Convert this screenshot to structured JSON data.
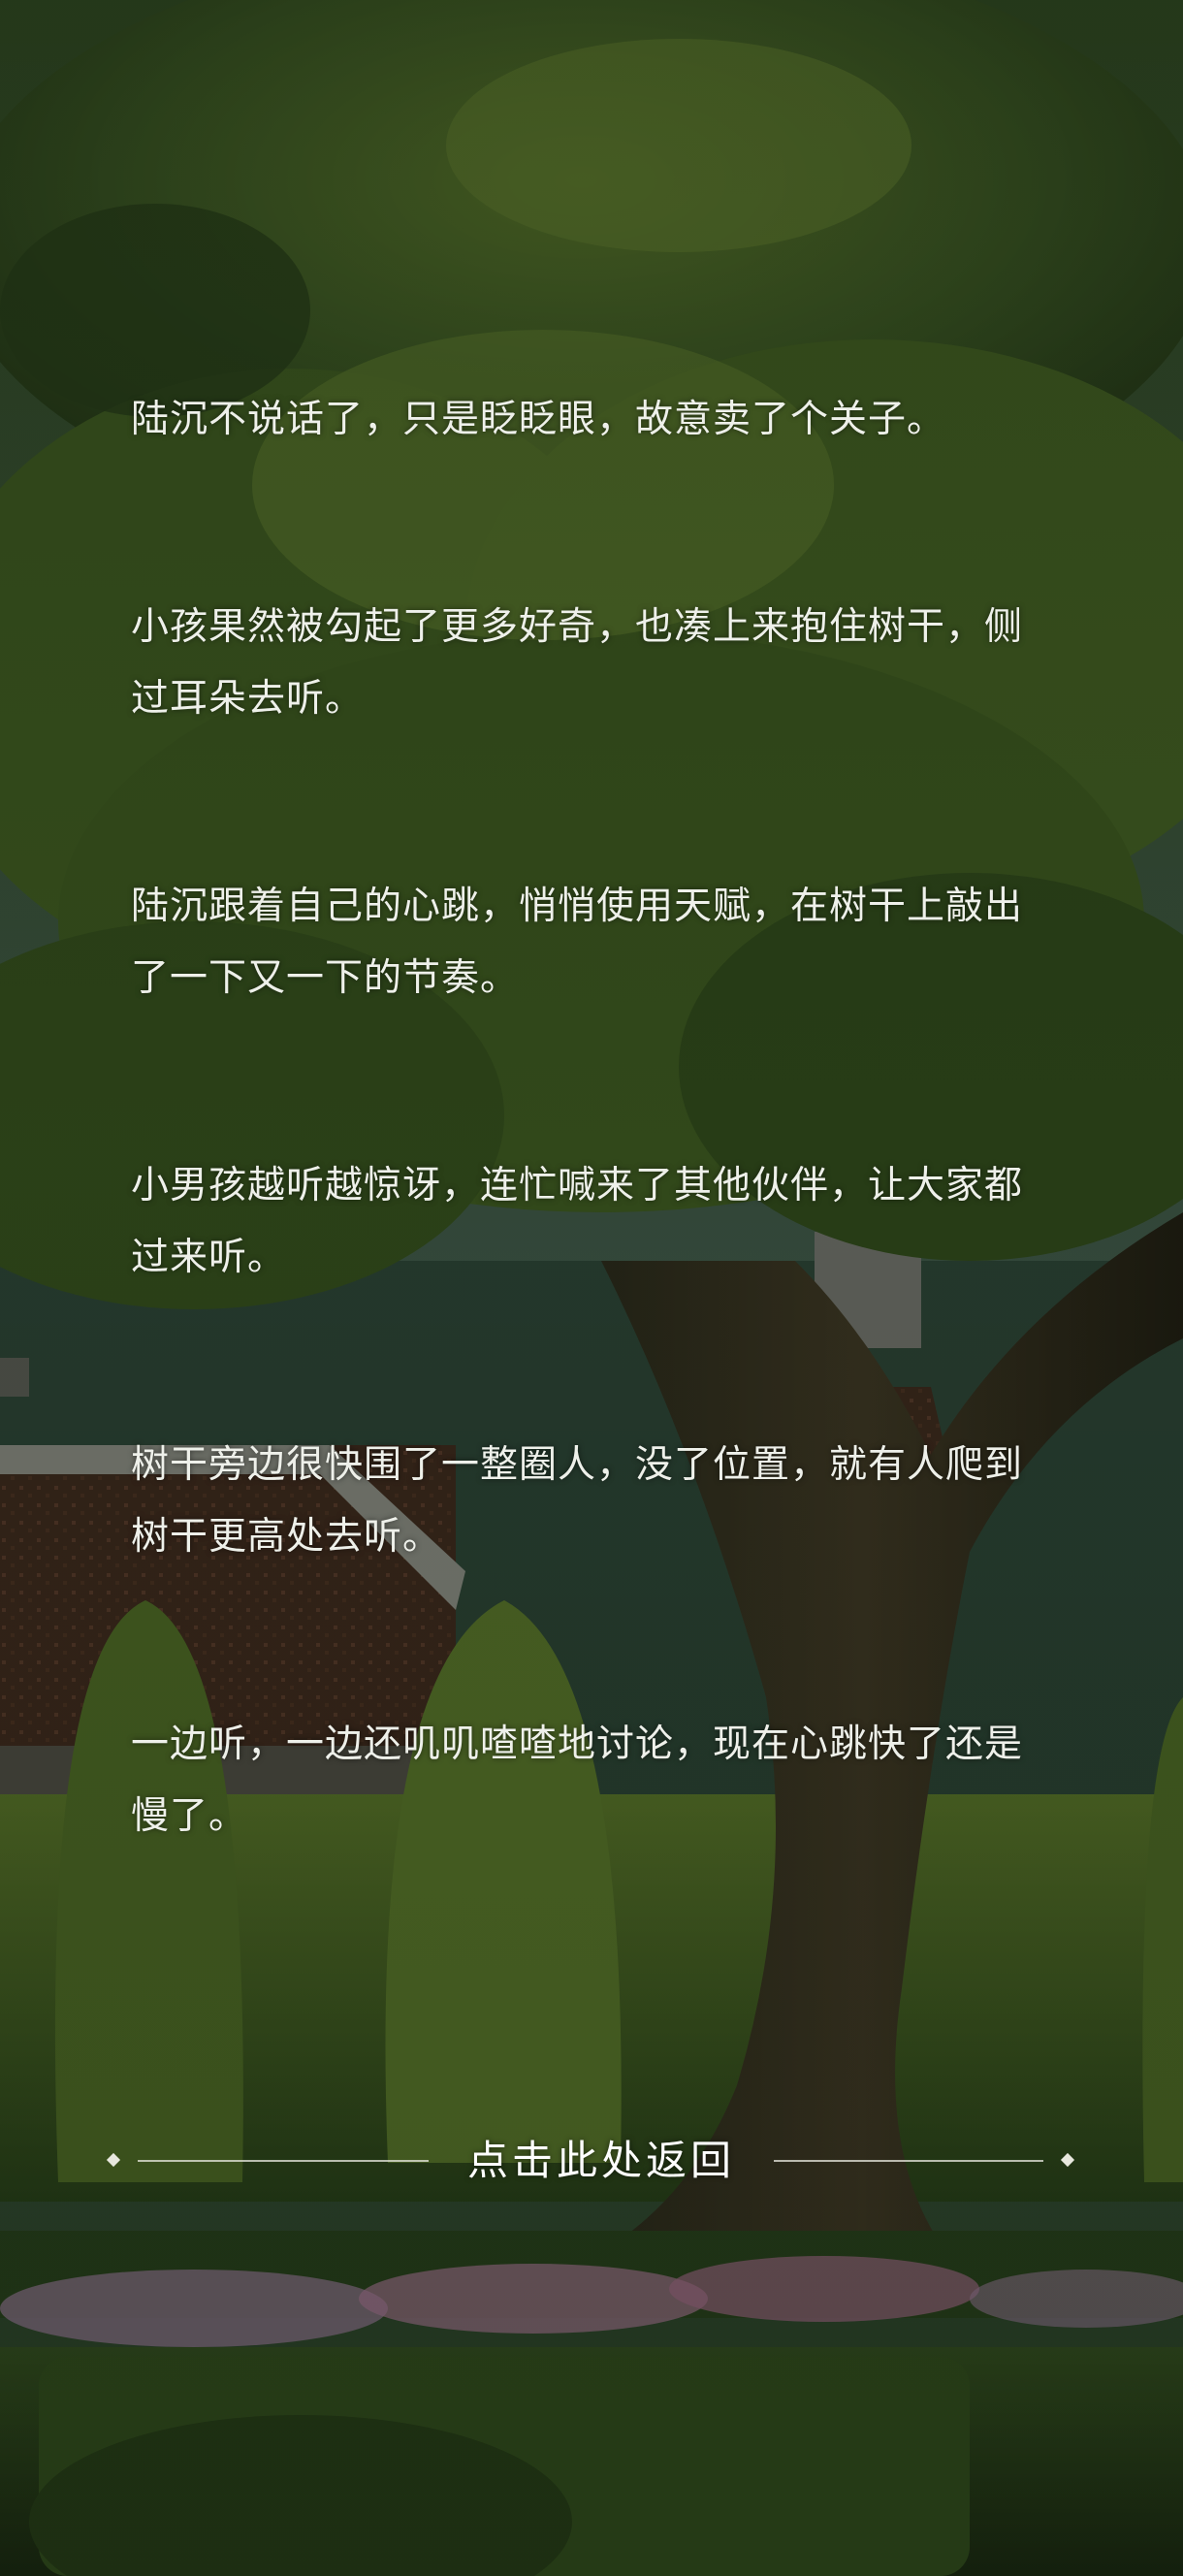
{
  "story": {
    "paragraphs": [
      "陆沉不说话了，只是眨眨眼，故意卖了个关子。",
      "小孩果然被勾起了更多好奇，也凑上来抱住树干，侧过耳朵去听。",
      "陆沉跟着自己的心跳，悄悄使用天赋，在树干上敲出了一下又一下的节奏。",
      "小男孩越听越惊讶，连忙喊来了其他伙伴，让大家都过来听。",
      "树干旁边很快围了一整圈人，没了位置，就有人爬到树干更高处去听。",
      "一边听，一边还叽叽喳喳地讨论，现在心跳快了还是慢了。"
    ]
  },
  "return_button": {
    "label": "点击此处返回"
  },
  "colors": {
    "text": "#eef0ea",
    "foliage": "#3f5a22",
    "sky": "#4d6a78",
    "roof": "#4a2e22",
    "flowers": "#c98bb0"
  }
}
